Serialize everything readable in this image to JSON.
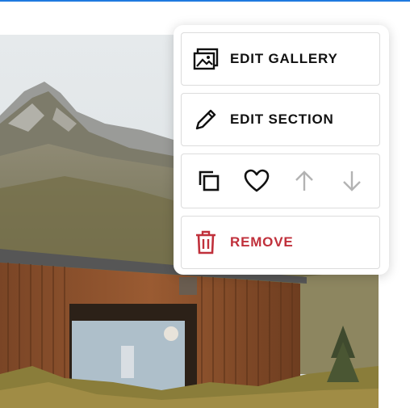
{
  "menu": {
    "edit_gallery_label": "EDIT GALLERY",
    "edit_section_label": "EDIT SECTION",
    "remove_label": "REMOVE",
    "icons": {
      "gallery": "image-gallery-icon",
      "section": "pencil-icon",
      "duplicate": "duplicate-icon",
      "favorite": "heart-icon",
      "move_up": "arrow-up-icon",
      "move_down": "arrow-down-icon",
      "remove": "trash-icon"
    },
    "colors": {
      "remove": "#c0303b",
      "disabled_arrow": "#b3b3b3",
      "text": "#111111"
    }
  },
  "background": {
    "description_color_sky": "#dfe4e6",
    "accent_top_bar": "#1f7ae0"
  }
}
